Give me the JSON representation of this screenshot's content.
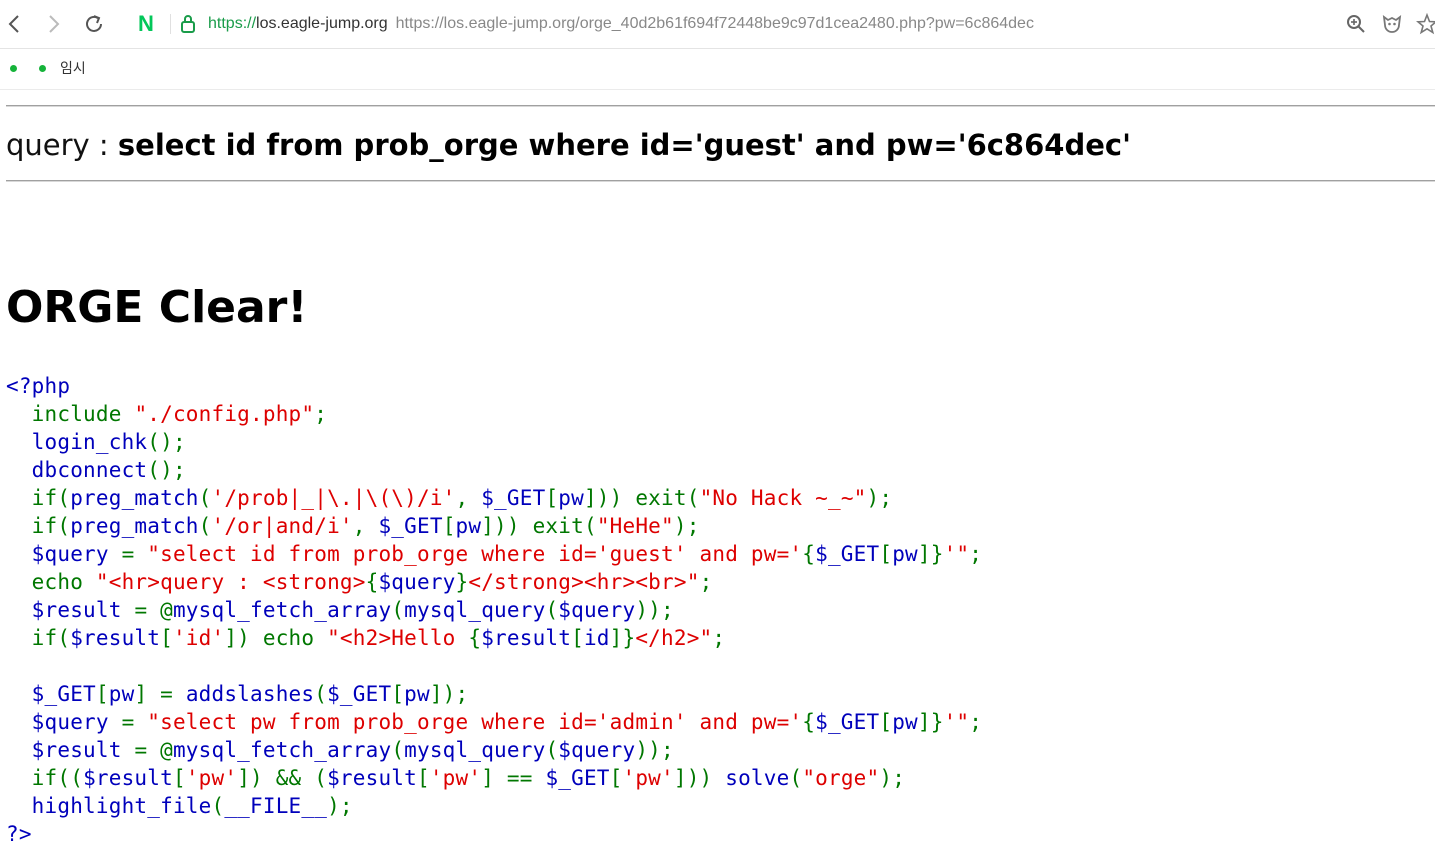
{
  "browser": {
    "url_scheme": "https://",
    "url_host": "los.eagle-jump.org",
    "url_full": "https://los.eagle-jump.org/orge_40d2b61f694f72448be9c97d1cea2480.php?pw=6c864dec",
    "bookmarks": [
      {
        "label": ""
      },
      {
        "label": "임시"
      }
    ],
    "colors": {
      "naver": "#03c75a",
      "secure": "#1a9c4a"
    }
  },
  "page": {
    "query_label": "query : ",
    "query_text": "select id from prob_orge where id='guest' and pw='6c864dec'",
    "heading": "ORGE Clear!",
    "code_colors": {
      "default": "#0000BB",
      "keyword": "#007700",
      "string": "#DD0000"
    },
    "code": [
      [
        [
          "d",
          "<?php"
        ]
      ],
      [
        [
          "k",
          "  include "
        ],
        [
          "s",
          "\"./config.php\""
        ],
        [
          "k",
          ";"
        ]
      ],
      [
        [
          "d",
          "  login_chk"
        ],
        [
          "k",
          "();"
        ]
      ],
      [
        [
          "d",
          "  dbconnect"
        ],
        [
          "k",
          "();"
        ]
      ],
      [
        [
          "k",
          "  if("
        ],
        [
          "d",
          "preg_match"
        ],
        [
          "k",
          "("
        ],
        [
          "s",
          "'/prob|_|\\.|\\(\\)/i'"
        ],
        [
          "k",
          ", "
        ],
        [
          "d",
          "$_GET"
        ],
        [
          "k",
          "["
        ],
        [
          "d",
          "pw"
        ],
        [
          "k",
          "])) exit("
        ],
        [
          "s",
          "\"No Hack ~_~\""
        ],
        [
          "k",
          ");"
        ]
      ],
      [
        [
          "k",
          "  if("
        ],
        [
          "d",
          "preg_match"
        ],
        [
          "k",
          "("
        ],
        [
          "s",
          "'/or|and/i'"
        ],
        [
          "k",
          ", "
        ],
        [
          "d",
          "$_GET"
        ],
        [
          "k",
          "["
        ],
        [
          "d",
          "pw"
        ],
        [
          "k",
          "])) exit("
        ],
        [
          "s",
          "\"HeHe\""
        ],
        [
          "k",
          ");"
        ]
      ],
      [
        [
          "d",
          "  $query "
        ],
        [
          "k",
          "= "
        ],
        [
          "s",
          "\"select id from prob_orge where id='guest' and pw='"
        ],
        [
          "k",
          "{"
        ],
        [
          "d",
          "$_GET"
        ],
        [
          "k",
          "["
        ],
        [
          "d",
          "pw"
        ],
        [
          "k",
          "]}"
        ],
        [
          "s",
          "'\""
        ],
        [
          "k",
          ";"
        ]
      ],
      [
        [
          "k",
          "  echo "
        ],
        [
          "s",
          "\"<hr>query : <strong>"
        ],
        [
          "k",
          "{"
        ],
        [
          "d",
          "$query"
        ],
        [
          "k",
          "}"
        ],
        [
          "s",
          "</strong><hr><br>\""
        ],
        [
          "k",
          ";"
        ]
      ],
      [
        [
          "d",
          "  $result "
        ],
        [
          "k",
          "= @"
        ],
        [
          "d",
          "mysql_fetch_array"
        ],
        [
          "k",
          "("
        ],
        [
          "d",
          "mysql_query"
        ],
        [
          "k",
          "("
        ],
        [
          "d",
          "$query"
        ],
        [
          "k",
          "));"
        ]
      ],
      [
        [
          "k",
          "  if("
        ],
        [
          "d",
          "$result"
        ],
        [
          "k",
          "["
        ],
        [
          "s",
          "'id'"
        ],
        [
          "k",
          "]) echo "
        ],
        [
          "s",
          "\"<h2>Hello "
        ],
        [
          "k",
          "{"
        ],
        [
          "d",
          "$result"
        ],
        [
          "k",
          "["
        ],
        [
          "d",
          "id"
        ],
        [
          "k",
          "]}"
        ],
        [
          "s",
          "</h2>\""
        ],
        [
          "k",
          ";"
        ]
      ],
      [
        [
          "d",
          ""
        ]
      ],
      [
        [
          "d",
          "  $_GET"
        ],
        [
          "k",
          "["
        ],
        [
          "d",
          "pw"
        ],
        [
          "k",
          "] = "
        ],
        [
          "d",
          "addslashes"
        ],
        [
          "k",
          "("
        ],
        [
          "d",
          "$_GET"
        ],
        [
          "k",
          "["
        ],
        [
          "d",
          "pw"
        ],
        [
          "k",
          "]);"
        ]
      ],
      [
        [
          "d",
          "  $query "
        ],
        [
          "k",
          "= "
        ],
        [
          "s",
          "\"select pw from prob_orge where id='admin' and pw='"
        ],
        [
          "k",
          "{"
        ],
        [
          "d",
          "$_GET"
        ],
        [
          "k",
          "["
        ],
        [
          "d",
          "pw"
        ],
        [
          "k",
          "]}"
        ],
        [
          "s",
          "'\""
        ],
        [
          "k",
          ";"
        ]
      ],
      [
        [
          "d",
          "  $result "
        ],
        [
          "k",
          "= @"
        ],
        [
          "d",
          "mysql_fetch_array"
        ],
        [
          "k",
          "("
        ],
        [
          "d",
          "mysql_query"
        ],
        [
          "k",
          "("
        ],
        [
          "d",
          "$query"
        ],
        [
          "k",
          "));"
        ]
      ],
      [
        [
          "k",
          "  if(("
        ],
        [
          "d",
          "$result"
        ],
        [
          "k",
          "["
        ],
        [
          "s",
          "'pw'"
        ],
        [
          "k",
          "]) && ("
        ],
        [
          "d",
          "$result"
        ],
        [
          "k",
          "["
        ],
        [
          "s",
          "'pw'"
        ],
        [
          "k",
          "] == "
        ],
        [
          "d",
          "$_GET"
        ],
        [
          "k",
          "["
        ],
        [
          "s",
          "'pw'"
        ],
        [
          "k",
          "])) "
        ],
        [
          "d",
          "solve"
        ],
        [
          "k",
          "("
        ],
        [
          "s",
          "\"orge\""
        ],
        [
          "k",
          ");"
        ]
      ],
      [
        [
          "d",
          "  highlight_file"
        ],
        [
          "k",
          "("
        ],
        [
          "d",
          "__FILE__"
        ],
        [
          "k",
          ");"
        ]
      ],
      [
        [
          "d",
          "?>"
        ]
      ]
    ]
  }
}
